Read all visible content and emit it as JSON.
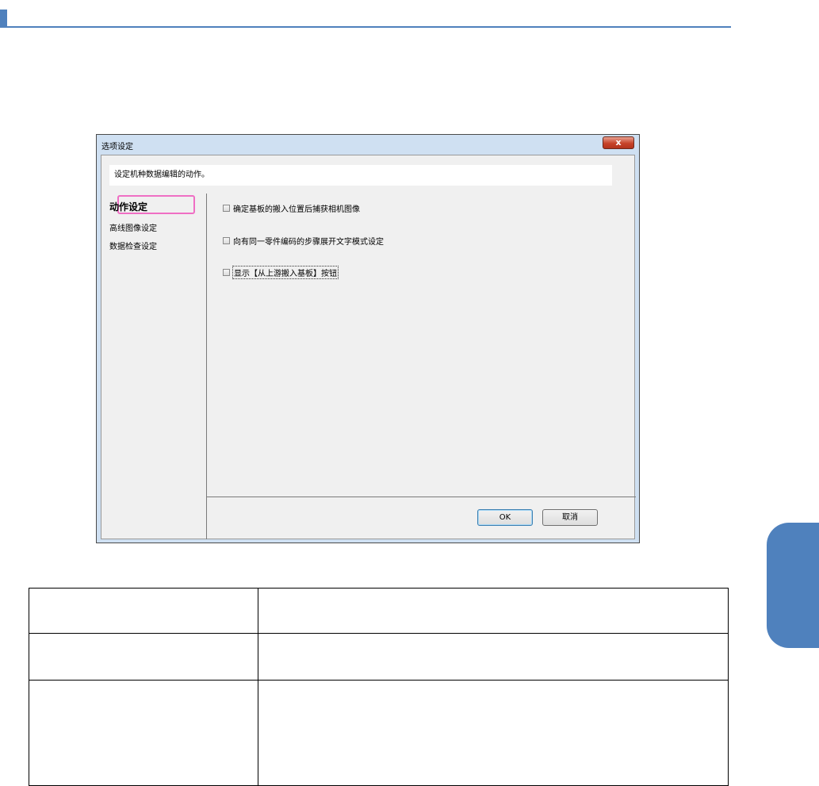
{
  "page": {
    "header_title": "",
    "side_tab_label": ""
  },
  "dialog": {
    "title": "选项设定",
    "close_label": "x",
    "description": "设定机种数据编辑的动作。",
    "nav_items": [
      {
        "label": "动作设定"
      },
      {
        "label": "高线图像设定"
      },
      {
        "label": "数据检查设定"
      }
    ],
    "options": [
      {
        "label": "确定基板的搬入位置后捕获相机图像",
        "checked": false
      },
      {
        "label": "向有同一零件编码的步骤展开文字模式设定",
        "checked": false
      },
      {
        "label": "显示【从上游搬入基板】按钮",
        "checked": false
      }
    ],
    "ok_label": "OK",
    "cancel_label": "取消"
  },
  "table": {
    "rows": [
      {
        "c1": "",
        "c2": ""
      },
      {
        "c1": "",
        "c2": ""
      },
      {
        "c1": "",
        "c2": ""
      }
    ]
  },
  "colors": {
    "accent": "#4f81bd",
    "highlight": "#ef6fc4"
  }
}
